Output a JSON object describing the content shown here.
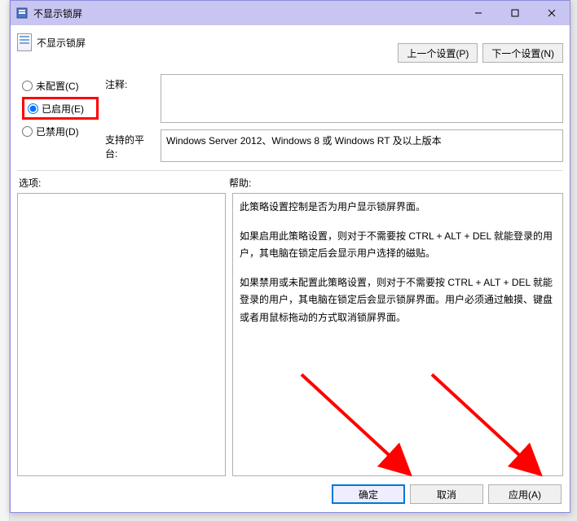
{
  "window": {
    "title": "不显示锁屏"
  },
  "header": {
    "policy_title": "不显示锁屏",
    "prev_setting": "上一个设置(P)",
    "next_setting": "下一个设置(N)"
  },
  "radios": {
    "not_configured": "未配置(C)",
    "enabled": "已启用(E)",
    "disabled": "已禁用(D)"
  },
  "fields": {
    "comment_label": "注释:",
    "comment_value": "",
    "supported_label": "支持的平台:",
    "supported_value": "Windows Server 2012、Windows 8 或 Windows RT 及以上版本"
  },
  "sections": {
    "options_label": "选项:",
    "help_label": "帮助:"
  },
  "help": {
    "p1": "此策略设置控制是否为用户显示锁屏界面。",
    "p2": "如果启用此策略设置，则对于不需要按 CTRL + ALT + DEL  就能登录的用户，其电脑在锁定后会显示用户选择的磁贴。",
    "p3": "如果禁用或未配置此策略设置，则对于不需要按 CTRL + ALT + DEL 就能登录的用户，其电脑在锁定后会显示锁屏界面。用户必须通过触摸、键盘或者用鼠标拖动的方式取消锁屏界面。"
  },
  "footer": {
    "ok": "确定",
    "cancel": "取消",
    "apply": "应用(A)"
  }
}
